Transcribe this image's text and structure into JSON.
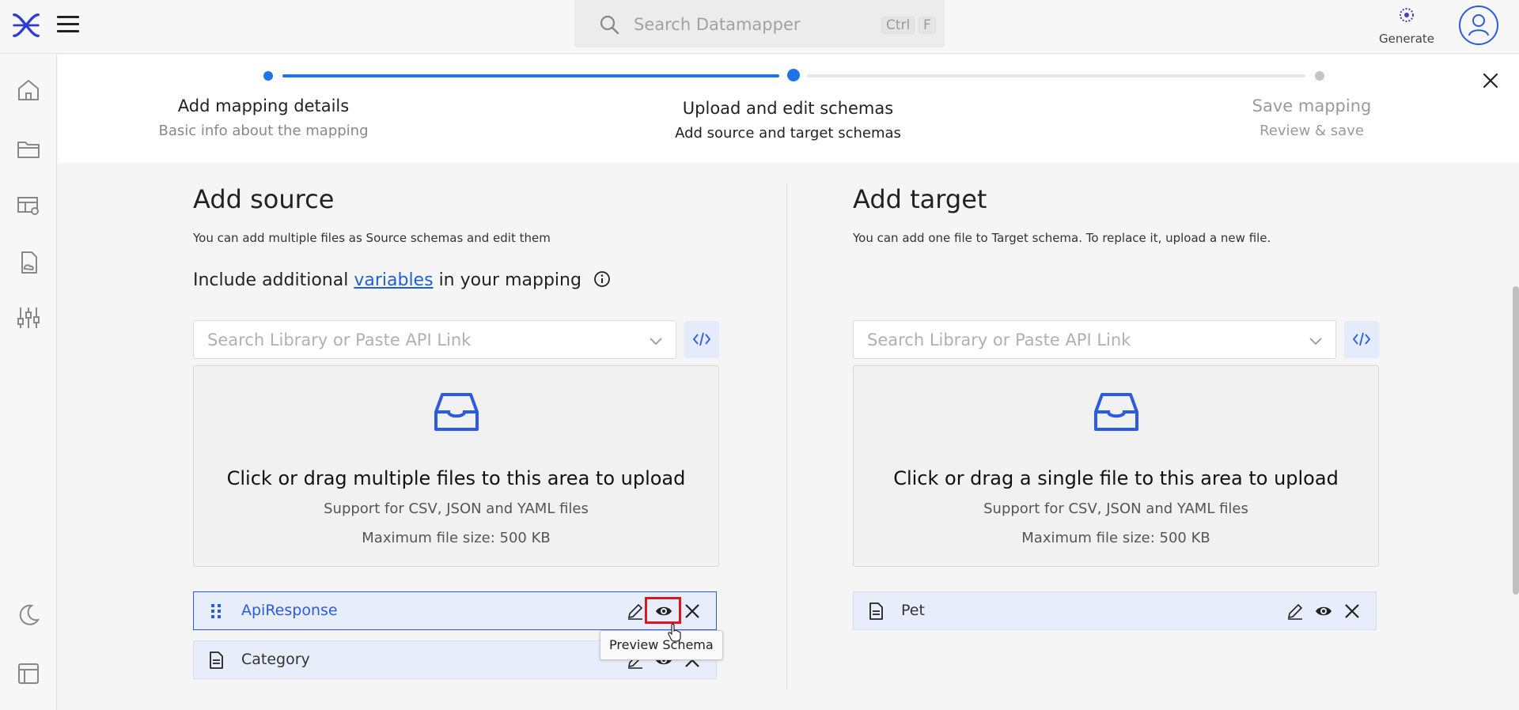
{
  "topbar": {
    "search_placeholder": "Search Datamapper",
    "shortcut_key1": "Ctrl",
    "shortcut_key2": "F",
    "generate_label": "Generate"
  },
  "stepper": {
    "steps": [
      {
        "title": "Add mapping details",
        "subtitle": "Basic info about the mapping",
        "state": "done"
      },
      {
        "title": "Upload and edit schemas",
        "subtitle": "Add source and target schemas",
        "state": "active"
      },
      {
        "title": "Save mapping",
        "subtitle": "Review & save",
        "state": "pending"
      }
    ]
  },
  "source": {
    "title": "Add source",
    "description": "You can add multiple files as Source schemas and edit them",
    "include_prefix": "Include additional",
    "include_link": "variables",
    "include_suffix": "in your mapping",
    "select_placeholder": "Search Library or Paste API Link",
    "drop_title": "Click or drag multiple files to this area to upload",
    "drop_support": "Support for CSV, JSON and YAML files",
    "drop_max": "Maximum file size: 500 KB",
    "files": [
      {
        "name": "ApiResponse",
        "icon": "drag-handle-icon"
      },
      {
        "name": "Category",
        "icon": "file-icon"
      }
    ]
  },
  "target": {
    "title": "Add target",
    "description": "You can add one file to Target schema. To replace it, upload a new file.",
    "select_placeholder": "Search Library or Paste API Link",
    "drop_title": "Click or drag a single file to this area to upload",
    "drop_support": "Support for CSV, JSON and YAML files",
    "drop_max": "Maximum file size: 500 KB",
    "files": [
      {
        "name": "Pet",
        "icon": "file-icon"
      }
    ]
  },
  "tooltip": {
    "text": "Preview Schema"
  },
  "colors": {
    "accent": "#2b5be0",
    "highlight": "#d9181f",
    "stepper_active": "#1f73e8"
  }
}
